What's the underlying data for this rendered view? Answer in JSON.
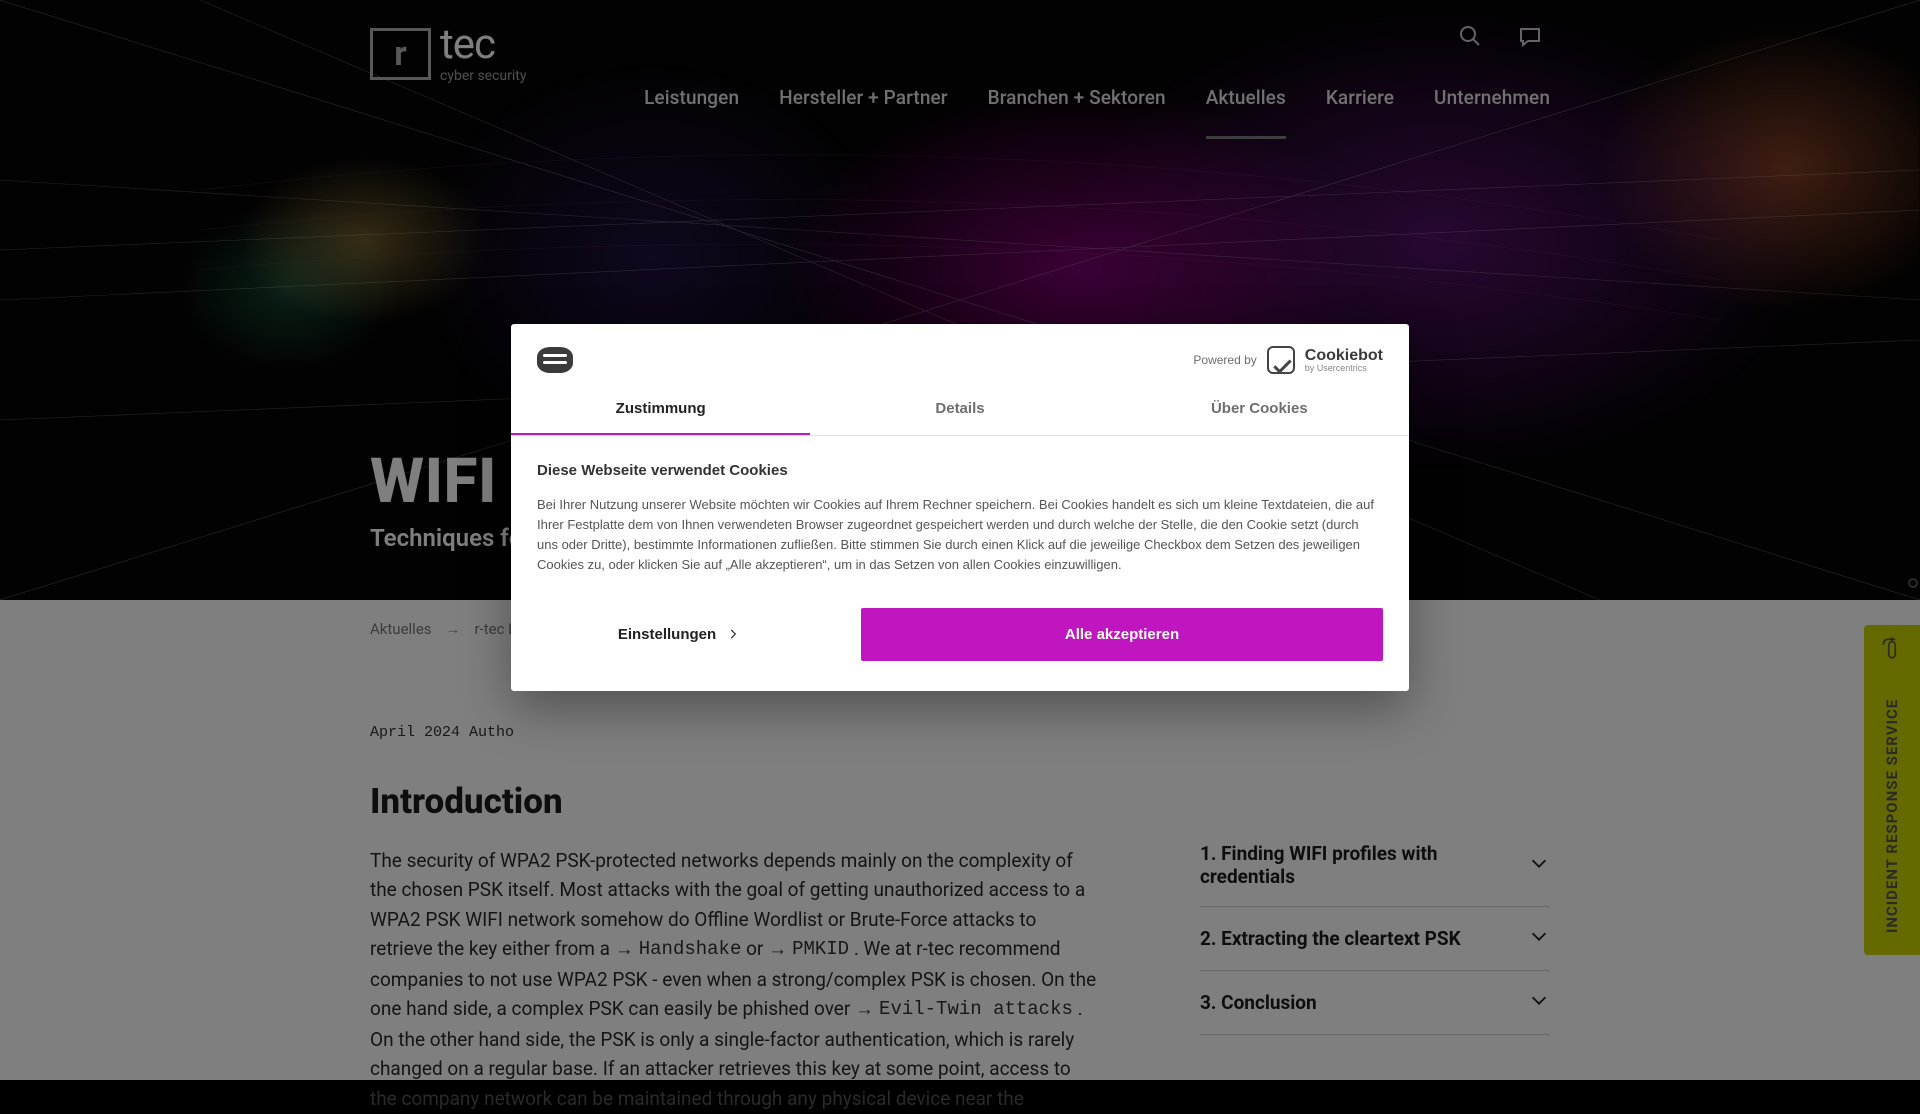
{
  "brand": {
    "mark_letter": "r",
    "name": "tec",
    "sub": "cyber security"
  },
  "nav": {
    "icons": {
      "search": "search-icon",
      "chat": "chat-icon"
    },
    "links": [
      {
        "label": "Leistungen"
      },
      {
        "label": "Hersteller + Partner"
      },
      {
        "label": "Branchen + Sektoren"
      },
      {
        "label": "Aktuelles",
        "active": true
      },
      {
        "label": "Karriere"
      },
      {
        "label": "Unternehmen"
      }
    ]
  },
  "hero": {
    "title": "WIFI",
    "subtitle": "Techniques for"
  },
  "breadcrumb": [
    "Aktuelles",
    "r-tec Blo"
  ],
  "article": {
    "meta": "April 2024 Autho",
    "heading": "Introduction",
    "body_before_link1": "The security of WPA2 PSK-protected networks depends mainly on the complexity of the chosen PSK itself. Most attacks with the goal of getting unauthorized access to a WPA2 PSK WIFI network somehow do Offline Wordlist or Brute-Force attacks to retrieve the key either from a ",
    "link1": "Handshake",
    "between_link1_link2": " or ",
    "link2": "PMKID",
    "after_link2_before_link3": ". We at r-tec recommend companies to not use WPA2 PSK - even when a strong/complex PSK is chosen. On the one hand side, a complex PSK can easily be phished over ",
    "link3": "Evil-Twin attacks",
    "after_link3": ". On the other hand side, the PSK is only a single-factor authentication, which is rarely changed on a regular base. If an attacker retrieves this key at some point, access to the company network can be maintained through any physical device near the"
  },
  "toc": [
    {
      "label": "1. Finding WIFI profiles with credentials"
    },
    {
      "label": "2. Extracting the cleartext PSK"
    },
    {
      "label": "3. Conclusion"
    }
  ],
  "irs": {
    "label": "INCIDENT RESPONSE SERVICE"
  },
  "modal": {
    "powered_by_label": "Powered by",
    "cookiebot_brand": "Cookiebot",
    "cookiebot_sub": "by Usercentrics",
    "tabs": [
      {
        "label": "Zustimmung",
        "active": true
      },
      {
        "label": "Details"
      },
      {
        "label": "Über Cookies"
      }
    ],
    "heading": "Diese Webseite verwendet Cookies",
    "body": "Bei Ihrer Nutzung unserer Website möchten wir Cookies auf Ihrem Rechner speichern. Bei Cookies handelt es sich um kleine Textdateien, die auf Ihrer Festplatte dem von Ihnen verwendeten Browser zugeordnet gespeichert werden und durch welche der Stelle, die den Cookie setzt (durch uns oder Dritte), bestimmte Informationen zufließen. Bitte stimmen Sie durch einen Klick auf die jeweilige Checkbox dem Setzen des jeweiligen Cookies zu, oder klicken Sie auf „Alle akzeptieren“, um in das Setzen von allen Cookies einzuwilligen.",
    "settings_label": "Einstellungen",
    "accept_label": "Alle akzeptieren"
  },
  "colors": {
    "accent_magenta": "#bf16bf",
    "irs_yellow": "#c9d300"
  }
}
